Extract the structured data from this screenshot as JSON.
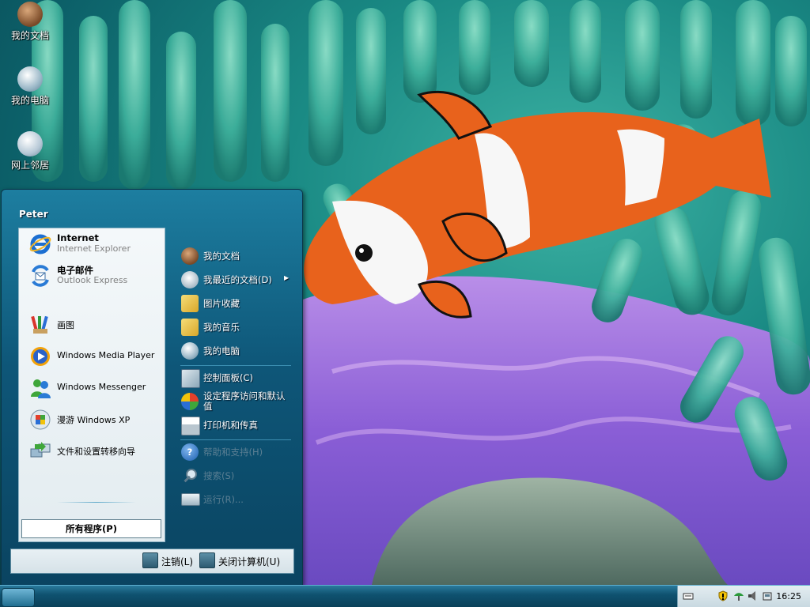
{
  "desktop": {
    "icons": [
      {
        "label": "我的文档",
        "icon": "my-documents-icon"
      },
      {
        "label": "我的电脑",
        "icon": "my-computer-icon"
      },
      {
        "label": "网上邻居",
        "icon": "network-places-icon"
      }
    ]
  },
  "start_menu": {
    "user_name": "Peter",
    "pinned": [
      {
        "title": "Internet",
        "subtitle": "Internet Explorer",
        "icon": "internet-explorer-icon"
      },
      {
        "title": "电子邮件",
        "subtitle": "Outlook Express",
        "icon": "outlook-express-icon"
      }
    ],
    "recent": [
      {
        "label": "画图",
        "icon": "paint-icon"
      },
      {
        "label": "Windows Media Player",
        "icon": "media-player-icon"
      },
      {
        "label": "Windows Messenger",
        "icon": "messenger-icon"
      },
      {
        "label": "漫游 Windows XP",
        "icon": "tour-xp-icon"
      },
      {
        "label": "文件和设置转移向导",
        "icon": "transfer-wizard-icon"
      }
    ],
    "all_programs_label": "所有程序(P)",
    "right_items": [
      {
        "label": "我的文档",
        "icon": "my-documents-icon"
      },
      {
        "label": "我最近的文档(D)",
        "icon": "recent-documents-icon",
        "has_submenu": true
      },
      {
        "label": "图片收藏",
        "icon": "my-pictures-icon"
      },
      {
        "label": "我的音乐",
        "icon": "my-music-icon"
      },
      {
        "label": "我的电脑",
        "icon": "my-computer-icon"
      }
    ],
    "right_items_system": [
      {
        "label": "控制面板(C)",
        "icon": "control-panel-icon"
      },
      {
        "label": "设定程序访问和默认值",
        "icon": "program-access-icon"
      },
      {
        "label": "打印机和传真",
        "icon": "printers-icon"
      },
      {
        "label": "帮助和支持(H)",
        "icon": "help-icon"
      },
      {
        "label": "搜索(S)",
        "icon": "search-icon"
      },
      {
        "label": "运行(R)...",
        "icon": "run-icon"
      }
    ],
    "footer": {
      "logoff_label": "注销(L)",
      "shutdown_label": "关闭计算机(U)"
    }
  },
  "taskbar": {
    "clock": "16:25",
    "tray_icons": [
      "keyboard-icon",
      "security-shield-icon",
      "network-icon",
      "speaker-icon",
      "safely-remove-icon"
    ]
  },
  "colors": {
    "accent": "#0e5678",
    "taskbar": "#0f5270"
  }
}
